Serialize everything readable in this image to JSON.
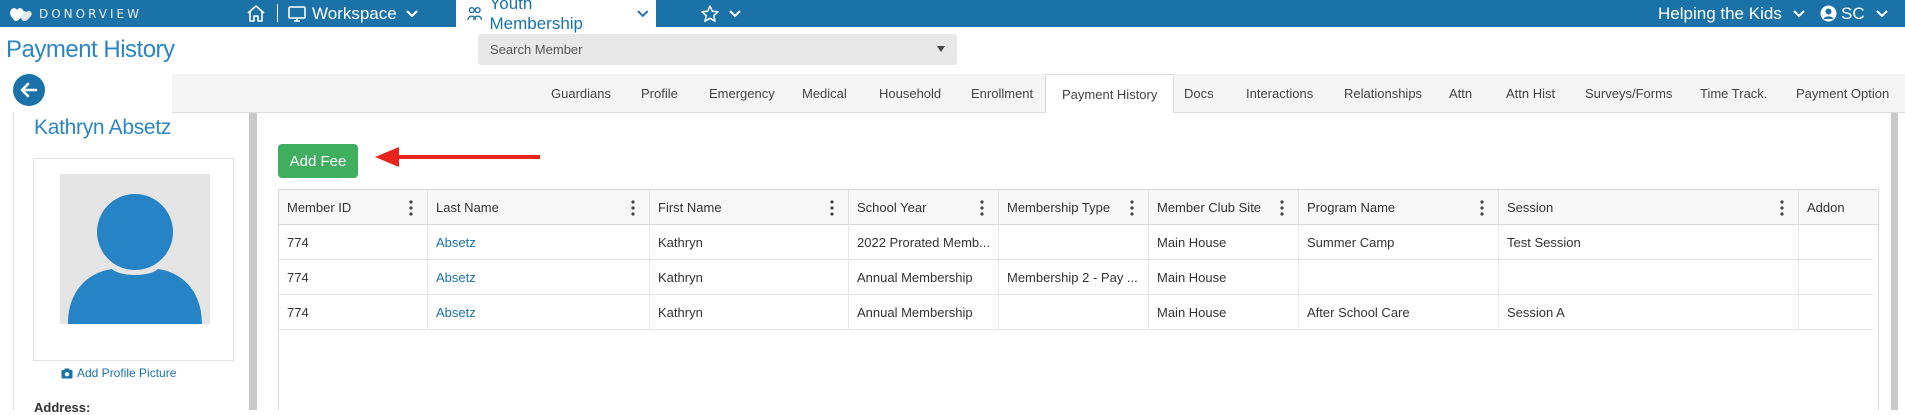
{
  "topbar": {
    "logo_text": "DONORVIEW",
    "workspace_label": "Workspace",
    "active_module": "Youth Membership",
    "org_name": "Helping the Kids",
    "user_initials": "SC"
  },
  "header": {
    "page_title": "Payment History",
    "search_placeholder": "Search Member"
  },
  "tabs": [
    {
      "label": "Guardians"
    },
    {
      "label": "Profile"
    },
    {
      "label": "Emergency"
    },
    {
      "label": "Medical"
    },
    {
      "label": "Household"
    },
    {
      "label": "Enrollment"
    },
    {
      "label": "Payment History",
      "active": true
    },
    {
      "label": "Docs"
    },
    {
      "label": "Interactions"
    },
    {
      "label": "Relationships"
    },
    {
      "label": "Attn"
    },
    {
      "label": "Attn Hist"
    },
    {
      "label": "Surveys/Forms"
    },
    {
      "label": "Time Track."
    },
    {
      "label": "Payment Option"
    }
  ],
  "profile": {
    "member_name": "Kathryn Absetz",
    "add_picture_label": "Add Profile Picture",
    "address_label": "Address:"
  },
  "actions": {
    "add_fee_label": "Add Fee"
  },
  "table": {
    "columns": [
      "Member ID",
      "Last Name",
      "First Name",
      "School Year",
      "Membership Type",
      "Member Club Site",
      "Program Name",
      "Session",
      "Addon"
    ],
    "rows": [
      [
        "774",
        "Absetz",
        "Kathryn",
        "2022 Prorated Memb...",
        "",
        "Main House",
        "Summer Camp",
        "Test Session",
        ""
      ],
      [
        "774",
        "Absetz",
        "Kathryn",
        "Annual Membership",
        "Membership 2 - Pay ...",
        "Main House",
        "",
        "",
        ""
      ],
      [
        "774",
        "Absetz",
        "Kathryn",
        "Annual Membership",
        "",
        "Main House",
        "After School Care",
        "Session A",
        ""
      ]
    ]
  },
  "colors": {
    "brand_blue": "#1a72a8",
    "title_blue": "#2c86c3",
    "add_fee_green": "#3fae5f",
    "annotation_arrow_red": "#e8231b"
  },
  "icons": {
    "home": "home-icon",
    "workspace": "monitor-icon",
    "module": "youth-membership-icon",
    "favorites": "star-icon",
    "user": "user-circle-icon",
    "back": "arrow-left-icon",
    "camera": "camera-icon"
  }
}
